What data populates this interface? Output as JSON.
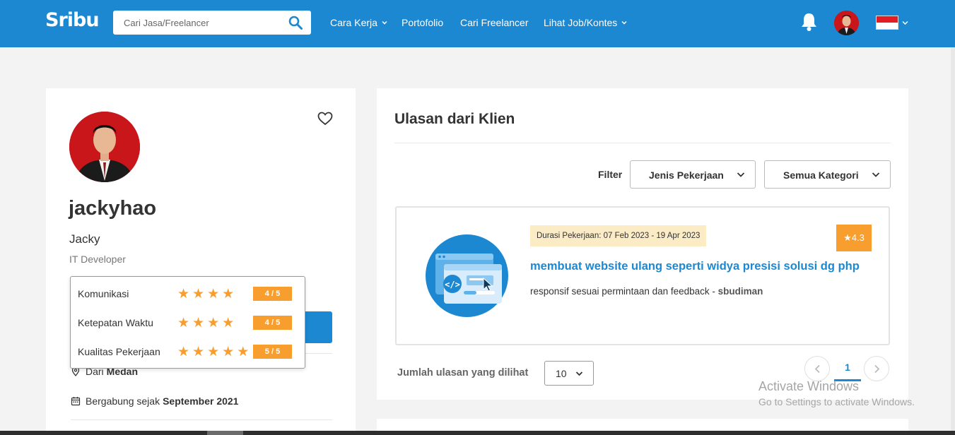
{
  "brand": {
    "logo_text": "Sribu",
    "accent_color": "#1c88d2"
  },
  "search": {
    "placeholder": "Cari Jasa/Freelancer",
    "icon": "search-icon"
  },
  "nav": {
    "items": [
      {
        "label": "Cara Kerja",
        "has_dropdown": true
      },
      {
        "label": "Portofolio",
        "has_dropdown": false
      },
      {
        "label": "Cari Freelancer",
        "has_dropdown": false
      },
      {
        "label": "Lihat Job/Kontes",
        "has_dropdown": true
      }
    ],
    "notification_icon": "bell-icon",
    "language_flag": "indonesia-flag"
  },
  "profile": {
    "username": "jackyhao",
    "display_name": "Jacky",
    "role": "IT Developer",
    "location_prefix": "Dari",
    "location": "Medan",
    "joined_prefix": "Bergabung sejak",
    "joined": "September 2021"
  },
  "ratings_popover": {
    "items": [
      {
        "label": "Komunikasi",
        "stars": 4,
        "score": "4 / 5"
      },
      {
        "label": "Ketepatan Waktu",
        "stars": 4,
        "score": "4 / 5"
      },
      {
        "label": "Kualitas Pekerjaan",
        "stars": 5,
        "score": "5 / 5"
      }
    ],
    "star_color": "#f89e2f"
  },
  "reviews": {
    "title": "Ulasan dari Klien",
    "filter_label": "Filter",
    "filter_job_type": "Jenis Pekerjaan",
    "filter_category": "Semua Kategori",
    "items": [
      {
        "duration": "Durasi Pekerjaan: 07 Feb 2023 - 19 Apr 2023",
        "rating": "★4.3",
        "title": "membuat website ulang seperti widya presisi solusi dg php",
        "comment": "responsif sesuai permintaan dan feedback -",
        "reviewer": "sbudiman"
      }
    ],
    "per_page_label": "Jumlah ulasan yang dilihat",
    "per_page_value": "10",
    "current_page": "1"
  },
  "watermark": {
    "line1": "Activate Windows",
    "line2": "Go to Settings to activate Windows."
  }
}
